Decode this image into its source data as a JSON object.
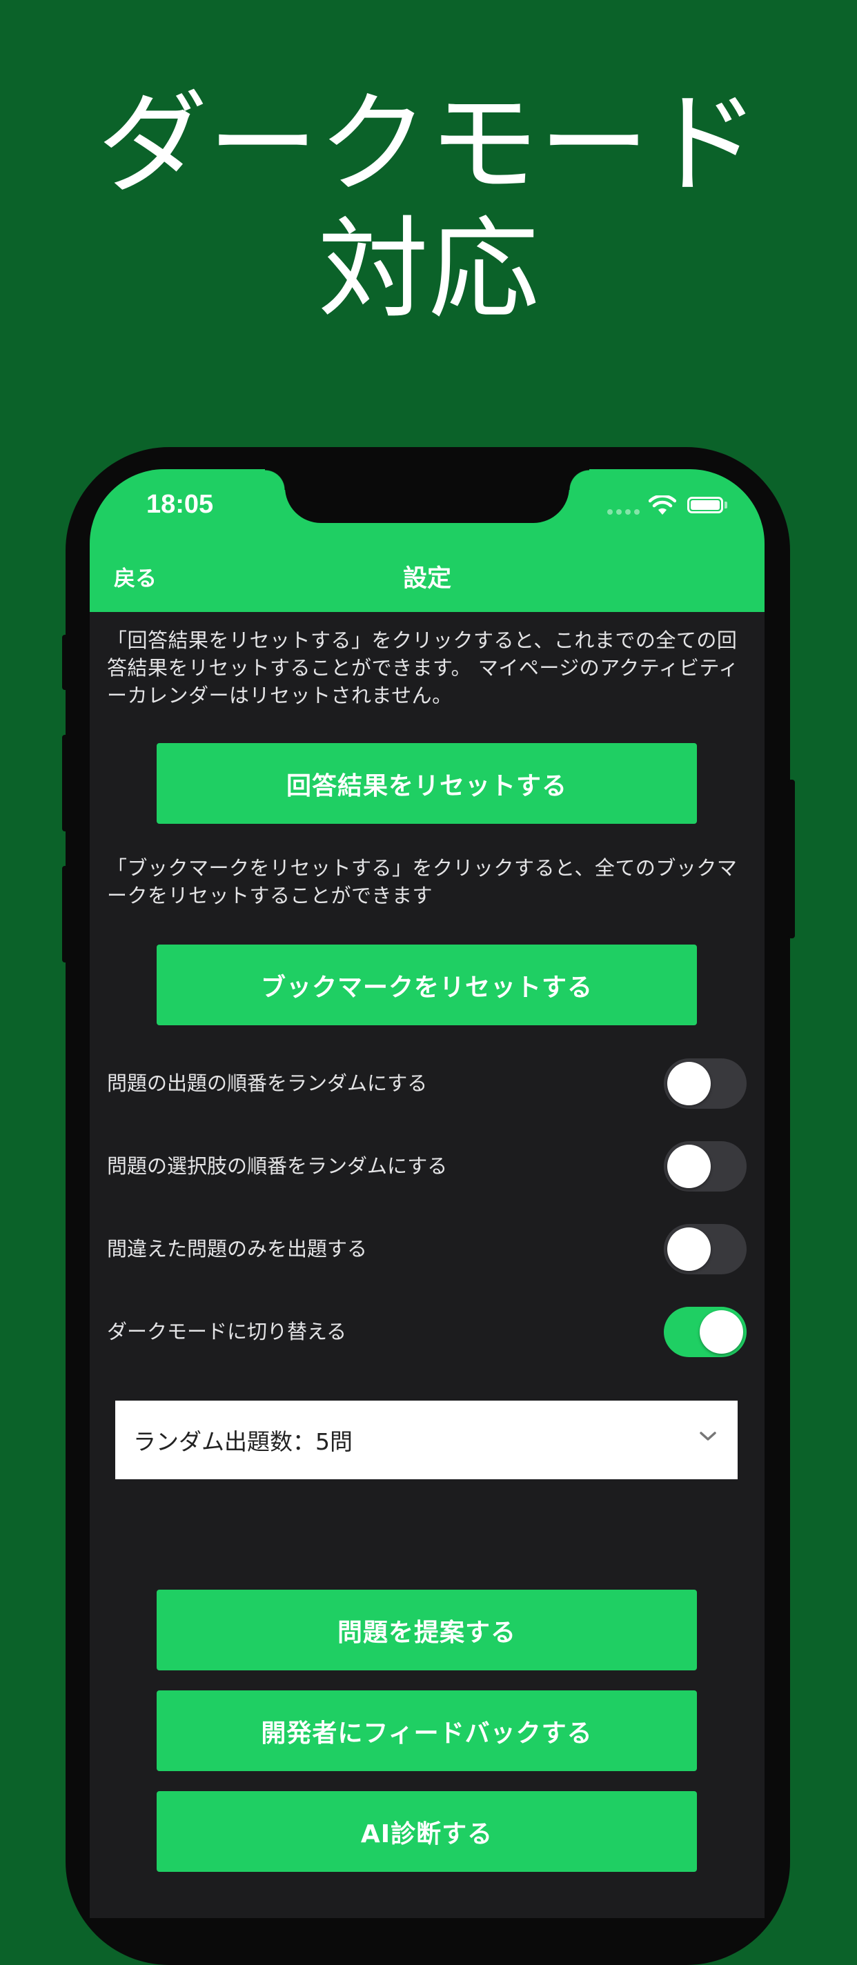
{
  "headline": {
    "line1": "ダークモード",
    "line2": "対応"
  },
  "status_bar": {
    "time": "18:05"
  },
  "nav": {
    "back_label": "戻る",
    "title": "設定"
  },
  "reset_answers": {
    "description": "「回答結果をリセットする」をクリックすると、これまでの全ての回答結果をリセットすることができます。 マイページのアクティビティーカレンダーはリセットされません。",
    "button_label": "回答結果をリセットする"
  },
  "reset_bookmarks": {
    "description": "「ブックマークをリセットする」をクリックすると、全てのブックマークをリセットすることができます",
    "button_label": "ブックマークをリセットする"
  },
  "toggles": [
    {
      "label": "問題の出題の順番をランダムにする",
      "on": false
    },
    {
      "label": "問題の選択肢の順番をランダムにする",
      "on": false
    },
    {
      "label": "間違えた問題のみを出題する",
      "on": false
    },
    {
      "label": "ダークモードに切り替える",
      "on": true
    }
  ],
  "random_count_select": {
    "value": "ランダム出題数：5問"
  },
  "actions": {
    "suggest_label": "問題を提案する",
    "feedback_label": "開発者にフィードバックする",
    "ai_label": "AI診断する"
  },
  "colors": {
    "background": "#0b6229",
    "accent": "#1fcf63",
    "screen": "#1c1c1e"
  },
  "icons": [
    "wifi-icon",
    "battery-icon",
    "chevron-down-icon"
  ]
}
